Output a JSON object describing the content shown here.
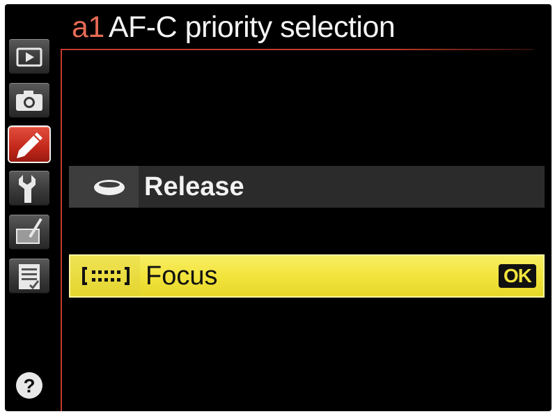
{
  "header": {
    "code": "a1",
    "title": "AF-C priority selection"
  },
  "sidebar": {
    "items": [
      {
        "name": "playback-menu",
        "icon": "play-icon",
        "active": false
      },
      {
        "name": "shooting-menu",
        "icon": "camera-icon",
        "active": false
      },
      {
        "name": "custom-settings-menu",
        "icon": "pencil-icon",
        "active": true
      },
      {
        "name": "setup-menu",
        "icon": "wrench-icon",
        "active": false
      },
      {
        "name": "retouch-menu",
        "icon": "brush-icon",
        "active": false
      },
      {
        "name": "my-menu",
        "icon": "checklist-icon",
        "active": false
      }
    ],
    "help_icon": "question-icon"
  },
  "options": [
    {
      "label": "Release",
      "icon": "release-icon",
      "selected": false
    },
    {
      "label": "Focus",
      "icon": "focus-brackets-icon",
      "selected": true,
      "badge": "OK"
    }
  ],
  "colors": {
    "accent_red": "#c23a2a",
    "title_code": "#e56a55",
    "selected_yellow": "#f2e43c",
    "active_tab": "#c2281a"
  }
}
